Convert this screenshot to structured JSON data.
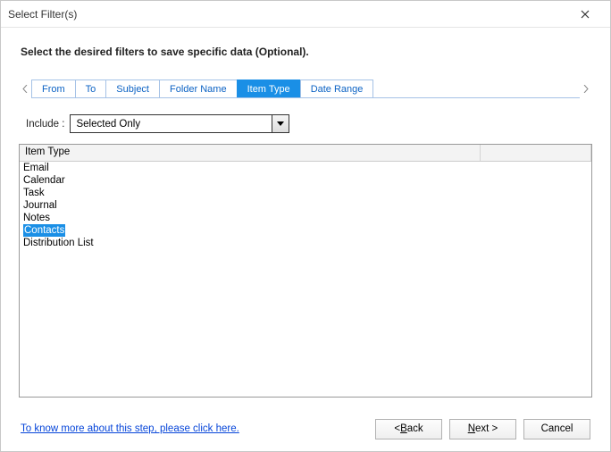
{
  "window": {
    "title": "Select Filter(s)"
  },
  "instruction": "Select the desired filters to save specific data (Optional).",
  "tabs": {
    "items": [
      "From",
      "To",
      "Subject",
      "Folder Name",
      "Item Type",
      "Date Range"
    ],
    "active_index": 4
  },
  "include": {
    "label": "Include :",
    "value": "Selected Only"
  },
  "list": {
    "header": "Item Type",
    "items": [
      "Email",
      "Calendar",
      "Task",
      "Journal",
      "Notes",
      "Contacts",
      "Distribution List"
    ],
    "selected_index": 5
  },
  "help_link": "To know more about this step, please click here.",
  "buttons": {
    "back": "< Back",
    "next": "Next >",
    "cancel": "Cancel"
  }
}
